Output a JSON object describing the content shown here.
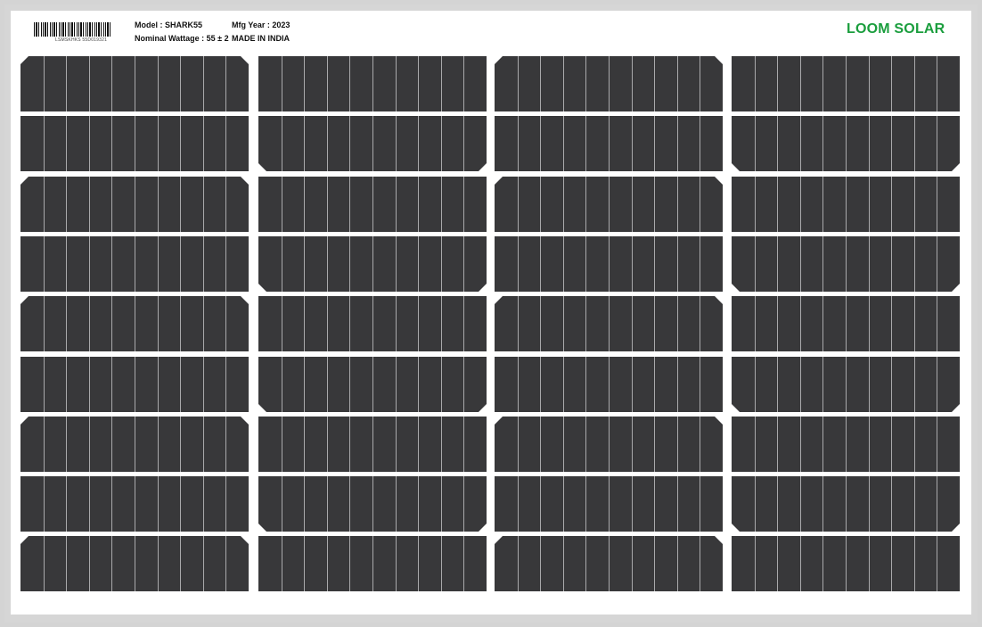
{
  "label": {
    "barcode_text": "LSMSKHKS 55D019321",
    "model": "Model : SHARK55",
    "wattage": "Nominal Wattage : 55 ± 2",
    "mfg_year": "Mfg Year : 2023",
    "origin": "MADE IN INDIA"
  },
  "brand": "LOOM SOLAR",
  "panel": {
    "cell_color": "#38383a",
    "busbar_color": "#a9a9ab",
    "frame_color": "#d6d6d6",
    "columns": 4,
    "rows": 9,
    "busbars_per_cell": 9,
    "beveled_corners": [
      [
        "top",
        "none",
        "top",
        "none"
      ],
      [
        "none",
        "bottom",
        "none",
        "bottom"
      ],
      [
        "top",
        "none",
        "top",
        "none"
      ],
      [
        "none",
        "bottom",
        "none",
        "bottom"
      ],
      [
        "top",
        "none",
        "top",
        "none"
      ],
      [
        "none",
        "bottom",
        "none",
        "bottom"
      ],
      [
        "top",
        "none",
        "top",
        "none"
      ],
      [
        "none",
        "bottom",
        "none",
        "bottom"
      ],
      [
        "top",
        "none",
        "top",
        "none"
      ]
    ]
  }
}
